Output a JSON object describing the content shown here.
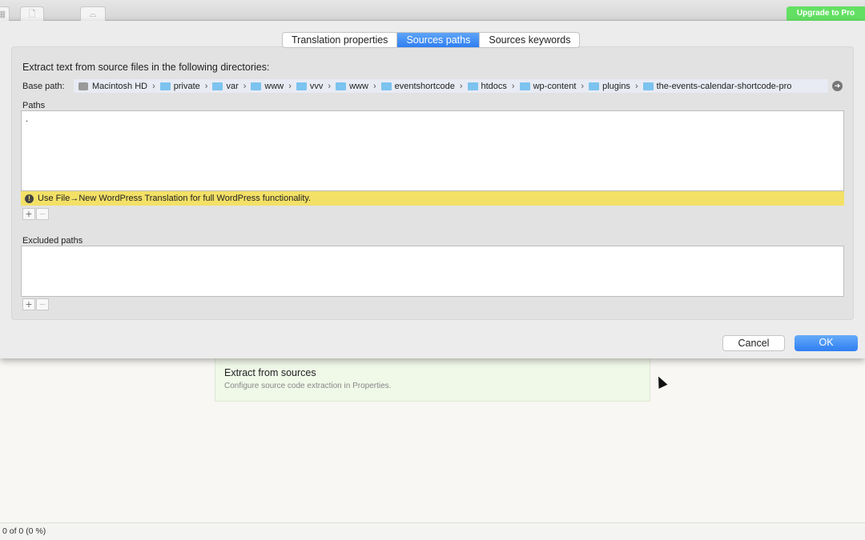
{
  "toolbar": {
    "upgrade_label": "Upgrade to Pro",
    "upgrade_color": "#63e063"
  },
  "dialog": {
    "tabs": [
      {
        "label": "Translation properties",
        "active": false
      },
      {
        "label": "Sources paths",
        "active": true
      },
      {
        "label": "Sources keywords",
        "active": false
      }
    ],
    "title": "Extract text from source files in the following directories:",
    "base_path_label": "Base path:",
    "base_path": [
      "Macintosh HD",
      "private",
      "var",
      "www",
      "vvv",
      "www",
      "eventshortcode",
      "htdocs",
      "wp-content",
      "plugins",
      "the-events-calendar-shortcode-pro"
    ],
    "paths_label": "Paths",
    "paths": [
      "."
    ],
    "warning": "Use File→New WordPress Translation for full WordPress functionality.",
    "excluded_label": "Excluded paths",
    "excluded": [],
    "add": "+",
    "remove": "−",
    "cancel": "Cancel",
    "ok": "OK"
  },
  "card": {
    "heading": "Extract from sources",
    "subtext": "Configure source code extraction in Properties."
  },
  "status": "0 of 0 (0 %)"
}
